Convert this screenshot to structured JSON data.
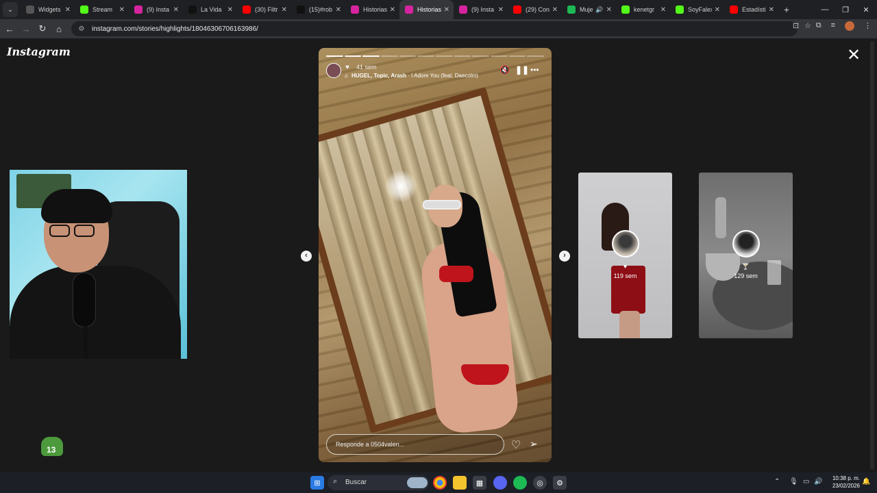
{
  "browser": {
    "tabs": [
      {
        "title": "Widgets",
        "icon": "widgets-icon",
        "color": "#555"
      },
      {
        "title": "Stream",
        "icon": "kick-icon",
        "color": "#53fc18"
      },
      {
        "title": "(9) Insta",
        "icon": "instagram-icon",
        "color": "#d6249f"
      },
      {
        "title": "La Vida",
        "icon": "tiktok-icon",
        "color": "#111"
      },
      {
        "title": "(30) Filtr",
        "icon": "youtube-icon",
        "color": "#ff0000"
      },
      {
        "title": "(15)#rob",
        "icon": "tiktok-icon",
        "color": "#111"
      },
      {
        "title": "Historias",
        "icon": "instagram-icon",
        "color": "#d6249f"
      },
      {
        "title": "Historias",
        "icon": "instagram-icon",
        "color": "#d6249f",
        "active": true
      },
      {
        "title": "(9) Insta",
        "icon": "instagram-icon",
        "color": "#d6249f"
      },
      {
        "title": "(29) Con",
        "icon": "youtube-icon",
        "color": "#ff0000"
      },
      {
        "title": "Muje",
        "icon": "spotify-icon",
        "color": "#1db954"
      },
      {
        "title": "kenetgr",
        "icon": "kick-icon",
        "color": "#53fc18"
      },
      {
        "title": "SoyFalex",
        "icon": "kick-icon",
        "color": "#53fc18"
      },
      {
        "title": "Estadísti",
        "icon": "youtube-icon",
        "color": "#ff0000"
      }
    ],
    "url": "instagram.com/stories/highlights/18046306706163986/"
  },
  "page": {
    "logo": "Instagram",
    "story": {
      "progress_done": 3,
      "progress_total": 12,
      "time": "41 sem",
      "song": "HUGEL, Topic, Arash",
      "song_title": " · I Adore You (feat. Daecolm)",
      "reply_placeholder": "Responde a 0504valen..."
    },
    "previews": [
      {
        "icon": "♥",
        "time": "119 sem"
      },
      {
        "icon": "🍸",
        "time": "129 sem"
      }
    ],
    "mascot_num": "13"
  },
  "taskbar": {
    "search_label": "Buscar",
    "time": "10:38 p. m.",
    "date": "23/02/2026"
  }
}
